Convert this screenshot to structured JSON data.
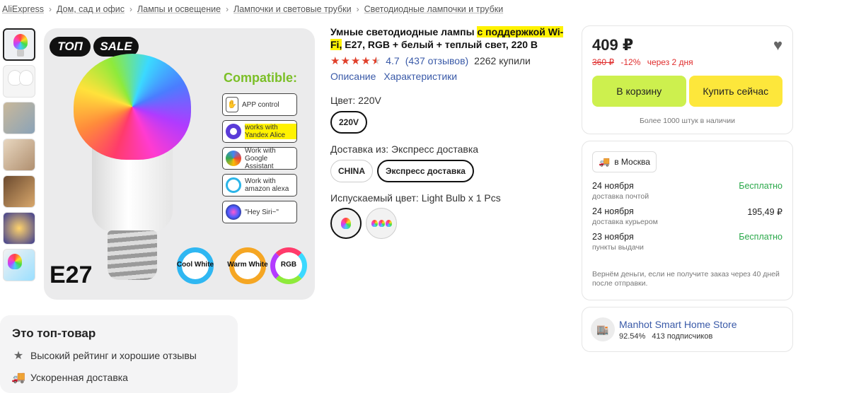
{
  "breadcrumb": [
    "AliExpress",
    "Дом, сад и офис",
    "Лампы и освещение",
    "Лампочки и световые трубки",
    "Светодиодные лампочки и трубки"
  ],
  "gallery": {
    "badge_top": "ТОП",
    "badge_sale": "SALE",
    "compatible_title": "Compatible:",
    "compat": [
      {
        "text": "APP control",
        "icon": "phone-icon"
      },
      {
        "text": "works with Yandex Alice",
        "icon": "alice-icon"
      },
      {
        "text": "Work with Google Assistant",
        "icon": "google-assistant-icon"
      },
      {
        "text": "Work with amazon alexa",
        "icon": "alexa-icon"
      },
      {
        "text": "\"Hey Siri~\"",
        "icon": "siri-icon"
      }
    ],
    "socket_label": "E27",
    "modes": [
      "Cool White",
      "Warm White",
      "RGB"
    ]
  },
  "top_product": {
    "title": "Это топ-товар",
    "features": [
      {
        "text": "Высокий рейтинг и хорошие отзывы",
        "icon": "star-icon"
      },
      {
        "text": "Ускоренная доставка",
        "icon": "truck-icon"
      }
    ]
  },
  "product": {
    "title_before": "Умные светодиодные лампы ",
    "title_highlight": "с поддержкой Wi-Fi,",
    "title_after": " E27, RGB + белый + теплый свет, 220 В",
    "rating": "4.7",
    "rating_stars": 4.5,
    "reviews": "(437 отзывов)",
    "sold": "2262 купили",
    "link_description": "Описание",
    "link_specs": "Характеристики",
    "color_label": "Цвет: 220V",
    "color_options": [
      "220V"
    ],
    "ship_label": "Доставка из: Экспресс доставка",
    "ship_options": [
      "CHINA",
      "Экспресс доставка"
    ],
    "emit_label": "Испускаемый цвет: Light Bulb x 1 Pcs"
  },
  "price": {
    "current": "409 ₽",
    "old": "360 ₽",
    "discount": "-12%",
    "timer": "через 2 дня",
    "cart_label": "В корзину",
    "buy_label": "Купить сейчас",
    "stock": "Более 1000 штук в наличии"
  },
  "delivery": {
    "city": "в Москва",
    "options": [
      {
        "date": "24 ноября",
        "type": "доставка почтой",
        "price": "Бесплатно",
        "free": true
      },
      {
        "date": "24 ноября",
        "type": "доставка курьером",
        "price": "195,49 ₽",
        "free": false
      },
      {
        "date": "23 ноября",
        "type": "пункты выдачи",
        "price": "Бесплатно",
        "free": true
      }
    ],
    "refund": "Вернём деньги, если не получите заказ через 40 дней после отправки."
  },
  "store": {
    "name": "Manhot Smart Home Store",
    "rating": "92.54%",
    "followers": "413 подписчиков"
  },
  "colors": {
    "link": "#3a5aa8",
    "cart": "#cdf04e",
    "buy": "#fde73b",
    "star": "#e0402b",
    "free": "#2aa84a"
  }
}
